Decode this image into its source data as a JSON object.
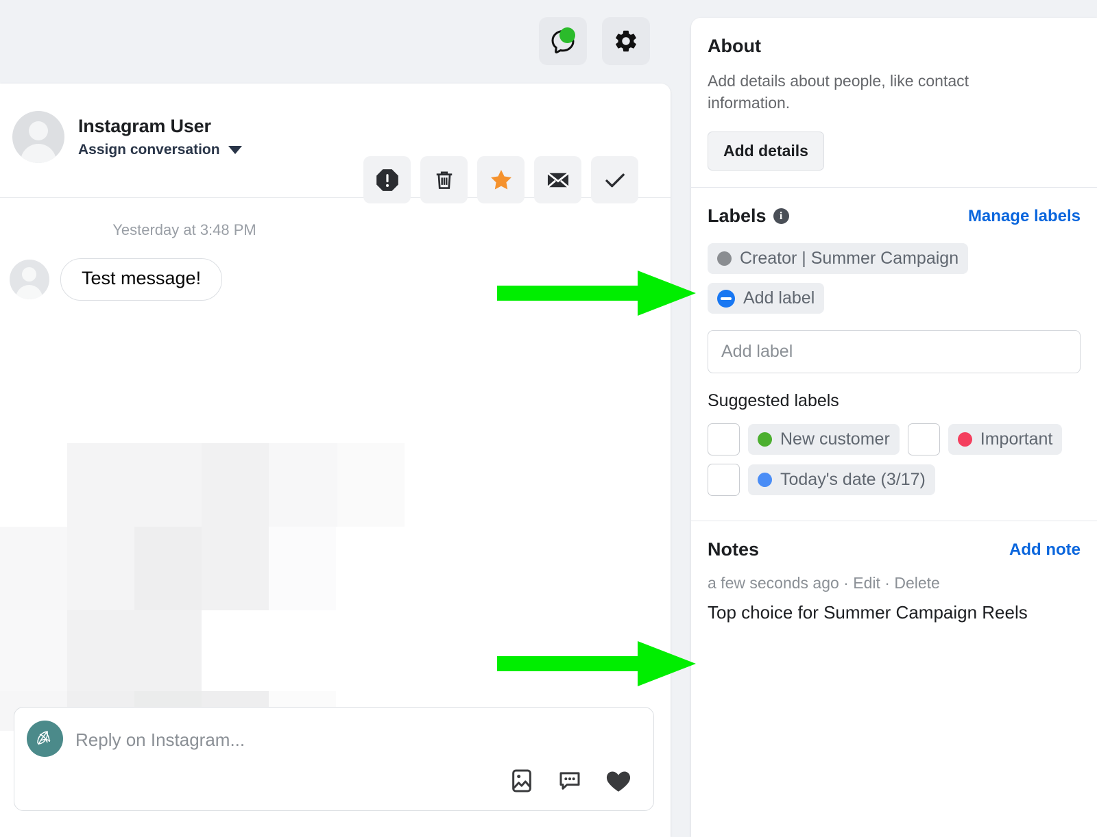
{
  "topbar": {
    "chat_icon": "chat-bubble-icon",
    "status_dot_color": "#2bbb2b",
    "settings_icon": "gear-icon"
  },
  "conversation": {
    "user_name": "Instagram User",
    "assign_label": "Assign conversation",
    "actions": [
      {
        "name": "mark-as-spam-button",
        "icon": "octagon-exclamation-icon"
      },
      {
        "name": "delete-button",
        "icon": "trash-icon"
      },
      {
        "name": "follow-up-button",
        "icon": "star-icon",
        "color": "#f5922d"
      },
      {
        "name": "mark-as-unread-button",
        "icon": "envelope-icon"
      },
      {
        "name": "mark-as-done-button",
        "icon": "check-icon"
      }
    ],
    "timestamp": "Yesterday at 3:48 PM",
    "message": "Test message!",
    "composer_placeholder": "Reply on Instagram...",
    "composer_icons": [
      {
        "name": "image-icon"
      },
      {
        "name": "saved-replies-icon"
      },
      {
        "name": "like-heart-icon"
      }
    ]
  },
  "about": {
    "title": "About",
    "description": "Add details about people, like contact information.",
    "add_details_label": "Add details"
  },
  "labels": {
    "title": "Labels",
    "manage_link": "Manage labels",
    "applied": [
      {
        "text": "Creator | Summer Campaign",
        "color": "#8a8d91"
      }
    ],
    "add_label_chip": "Add label",
    "input_placeholder": "Add label",
    "suggested_title": "Suggested labels",
    "suggested": [
      {
        "text": "New customer",
        "color": "#4caf2f"
      },
      {
        "text": "Important",
        "color": "#f43f5e"
      },
      {
        "text": "Today's date (3/17)",
        "color": "#4a8df6"
      }
    ]
  },
  "notes": {
    "title": "Notes",
    "add_note_link": "Add note",
    "meta_time": "a few seconds ago",
    "meta_sep": " · ",
    "edit_label": "Edit",
    "delete_label": "Delete",
    "note_text": "Top choice for Summer Campaign Reels"
  },
  "annotations": {
    "arrow_color": "#00ee00",
    "arrows": [
      {
        "name": "arrow-to-labels",
        "target": "Creator | Summer Campaign"
      },
      {
        "name": "arrow-to-note",
        "target": "Top choice for Summer Campaign Reels"
      }
    ]
  }
}
